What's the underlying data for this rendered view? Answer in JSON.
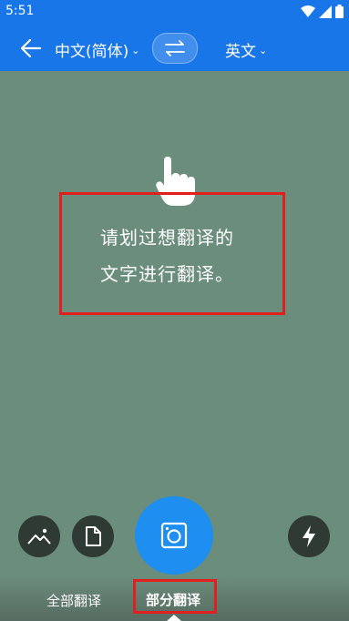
{
  "status_bar": {
    "time": "5:51"
  },
  "app_bar": {
    "source_language": "中文(简体)",
    "target_language": "英文",
    "dropdown_chevron": "⌄"
  },
  "camera_view": {
    "instruction_line1": "请划过想翻译的",
    "instruction_line2": "文字进行翻译。"
  },
  "modes": {
    "all_label": "全部翻译",
    "partial_label": "部分翻译",
    "selected": "部分翻译"
  },
  "colors": {
    "app_bar": "#1976e8",
    "camera_bg": "#6b8d7c",
    "highlight_box": "#e0201f",
    "shutter": "#1e8ef0",
    "round_button": "#2f3a35"
  },
  "icons": {
    "back": "arrow-left-icon",
    "swap": "swap-arrows-icon",
    "hand": "hand-pointer-icon",
    "gallery": "image-icon",
    "document": "document-icon",
    "camera": "camera-icon",
    "flash": "flash-icon"
  }
}
